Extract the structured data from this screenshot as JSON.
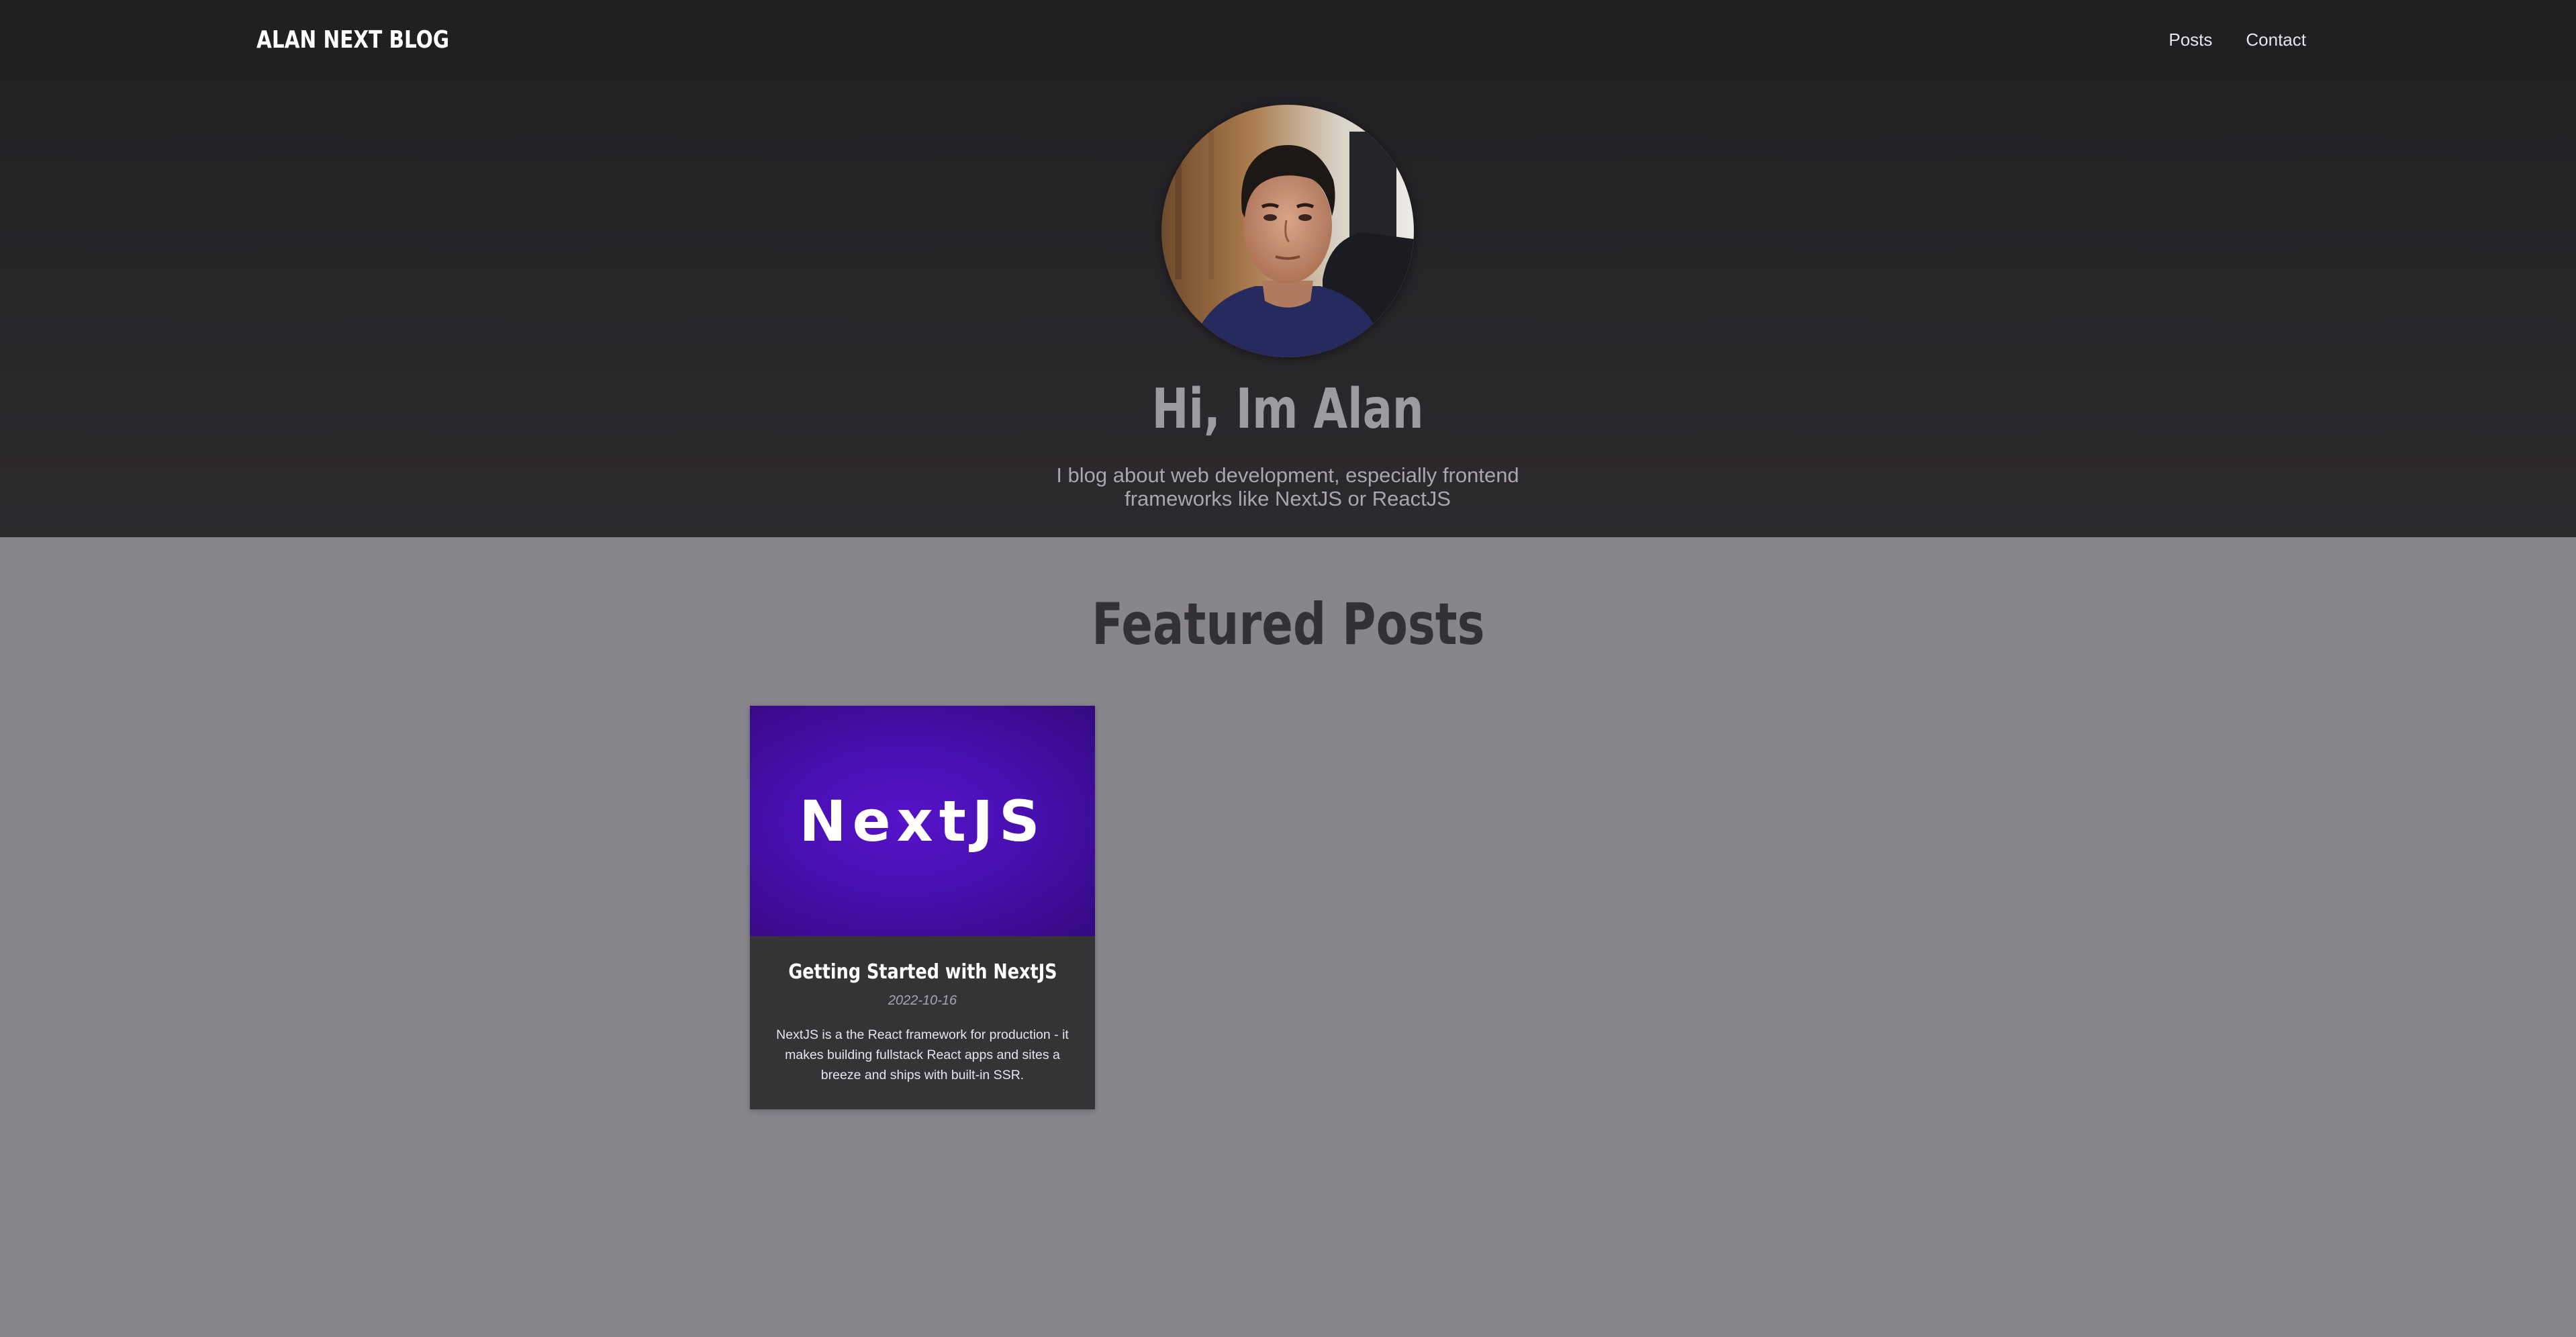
{
  "header": {
    "logo": "ALAN NEXT BLOG",
    "nav": [
      {
        "label": "Posts"
      },
      {
        "label": "Contact"
      }
    ]
  },
  "hero": {
    "title": "Hi, Im Alan",
    "subtitle": "I blog about web development, especially frontend frameworks like NextJS or ReactJS"
  },
  "featured": {
    "heading": "Featured Posts",
    "posts": [
      {
        "thumbnail_text": "NextJS",
        "title": "Getting Started with NextJS",
        "date": "2022-10-16",
        "excerpt": "NextJS is a the React framework for production - it makes building fullstack React apps and sites a breeze and ships with built-in SSR."
      }
    ]
  },
  "colors": {
    "header_bg": "#211f22",
    "page_bg": "#88858d",
    "card_bg": "#363337",
    "thumb_purple": "#4a10b5"
  }
}
